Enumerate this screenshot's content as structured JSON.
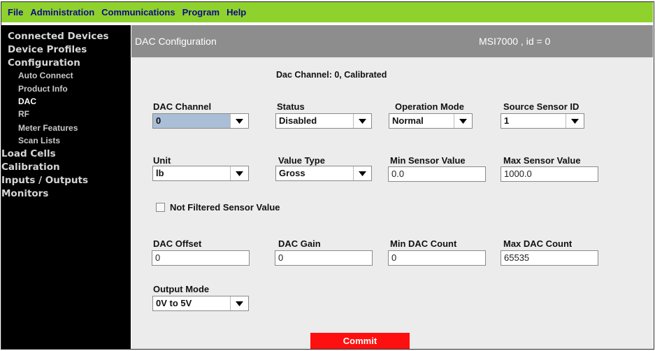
{
  "menu": [
    "File",
    "Administration",
    "Communications",
    "Program",
    "Help"
  ],
  "sidebar": {
    "items": [
      {
        "label": "Connected Devices",
        "level": 1
      },
      {
        "label": "Device Profiles",
        "level": 1
      },
      {
        "label": "Configuration",
        "level": 1
      },
      {
        "label": "Auto Connect",
        "level": 2
      },
      {
        "label": "Product Info",
        "level": 2
      },
      {
        "label": "DAC",
        "level": 2,
        "active": true
      },
      {
        "label": "RF",
        "level": 2
      },
      {
        "label": "Meter Features",
        "level": 2
      },
      {
        "label": "Scan Lists",
        "level": 2
      },
      {
        "label": "Load Cells",
        "level": 1
      },
      {
        "label": "Calibration",
        "level": 1
      },
      {
        "label": "Inputs / Outputs",
        "level": 1
      },
      {
        "label": "Monitors",
        "level": 1
      }
    ]
  },
  "header": {
    "title": "DAC Configuration",
    "device": "MSI7000 , id = 0"
  },
  "channel_header": "Dac Channel: 0, Calibrated",
  "fields": {
    "dac_channel": {
      "label": "DAC Channel",
      "value": "0"
    },
    "status": {
      "label": "Status",
      "value": "Disabled"
    },
    "operation_mode": {
      "label": "Operation Mode",
      "value": "Normal"
    },
    "source_sensor_id": {
      "label": "Source Sensor ID",
      "value": "1"
    },
    "unit": {
      "label": "Unit",
      "value": "lb"
    },
    "value_type": {
      "label": "Value Type",
      "value": "Gross"
    },
    "min_sensor_value": {
      "label": "Min Sensor Value",
      "value": "0.0"
    },
    "max_sensor_value": {
      "label": "Max Sensor Value",
      "value": "1000.0"
    },
    "not_filtered": {
      "label": "Not Filtered Sensor Value",
      "checked": false
    },
    "dac_offset": {
      "label": "DAC Offset",
      "value": "0"
    },
    "dac_gain": {
      "label": "DAC Gain",
      "value": "0"
    },
    "min_dac_count": {
      "label": "Min DAC Count",
      "value": "0"
    },
    "max_dac_count": {
      "label": "Max DAC Count",
      "value": "65535"
    },
    "output_mode": {
      "label": "Output Mode",
      "value": "0V to 5V"
    }
  },
  "commit_label": "Commit",
  "colors": {
    "menubar": "#8fd12d",
    "menu_text": "#0a0a8a",
    "sidebar": "#000000",
    "header": "#8d8d8d",
    "content": "#ececec",
    "commit": "#ff1010",
    "channel_highlight": "#aabfd6"
  }
}
